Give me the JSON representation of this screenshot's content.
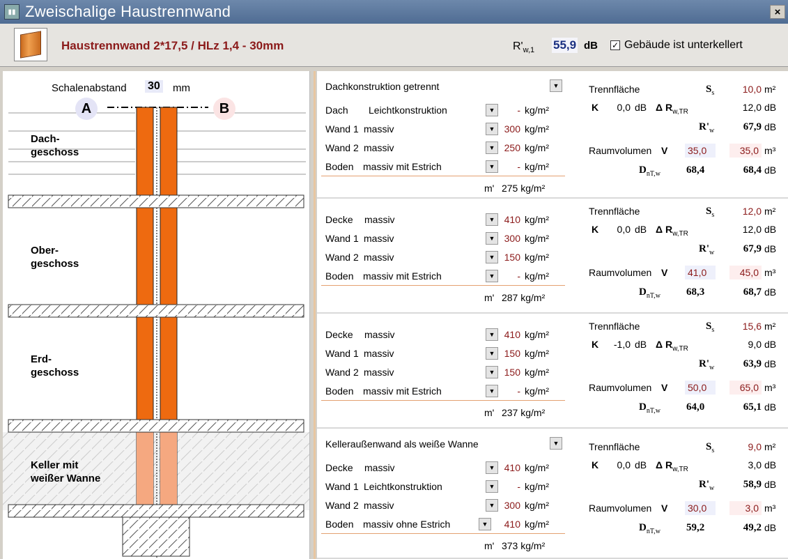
{
  "window": {
    "title": "Zweischalige Haustrennwand",
    "close": "×"
  },
  "header": {
    "wall_name": "Haustrennwand 2*17,5 / HLz 1,4 - 30mm",
    "rw_label": "R'",
    "rw_sub": "w,1",
    "rw_value": "55,9",
    "rw_unit": "dB",
    "basement_checked": true,
    "basement_label": "Gebäude ist unterkellert"
  },
  "diagram": {
    "spacing_label": "Schalenabstand",
    "spacing_value": "30",
    "spacing_unit": "mm",
    "side_a": "A",
    "side_b": "B",
    "floors": [
      {
        "l1": "Dach-",
        "l2": "geschoss"
      },
      {
        "l1": "Ober-",
        "l2": "geschoss"
      },
      {
        "l1": "Erd-",
        "l2": "geschoss"
      },
      {
        "l1": "Keller mit",
        "l2": "weißer Wanne"
      }
    ]
  },
  "units": {
    "kgm2": "kg/m²",
    "m2": "m²",
    "m3": "m³",
    "db": "dB",
    "dash": "-",
    "mprime": "m'"
  },
  "labels": {
    "trennflaeche": "Trennfläche",
    "ss": "S",
    "ss_sub": "s",
    "k": "K",
    "delta_r": "Δ R",
    "delta_r_sub": "w,TR",
    "r_w": "R'",
    "r_w_sub": "w",
    "raumvolumen": "Raumvolumen",
    "v": "V",
    "dnt": "D",
    "dnt_sub": "nT,w"
  },
  "sections": [
    {
      "title": "Dachkonstruktion getrennt",
      "rows": [
        {
          "label": "Dach",
          "value": "Leichtkonstruktion",
          "mass": "-"
        },
        {
          "label": "Wand 1",
          "value": "massiv",
          "mass": "300"
        },
        {
          "label": "Wand 2",
          "value": "massiv",
          "mass": "250"
        },
        {
          "label": "Boden",
          "value": "massiv mit Estrich",
          "mass": "-"
        }
      ],
      "m_total": "275",
      "ss": "10,0",
      "k": "0,0",
      "delta": "12,0",
      "r": "67,9",
      "v1": "35,0",
      "v2": "35,0",
      "d1": "68,4",
      "d2": "68,4"
    },
    {
      "title": "",
      "rows": [
        {
          "label": "Decke",
          "value": "massiv",
          "mass": "410"
        },
        {
          "label": "Wand 1",
          "value": "massiv",
          "mass": "300"
        },
        {
          "label": "Wand 2",
          "value": "massiv",
          "mass": "150"
        },
        {
          "label": "Boden",
          "value": "massiv mit Estrich",
          "mass": "-"
        }
      ],
      "m_total": "287",
      "ss": "12,0",
      "k": "0,0",
      "delta": "12,0",
      "r": "67,9",
      "v1": "41,0",
      "v2": "45,0",
      "d1": "68,3",
      "d2": "68,7"
    },
    {
      "title": "",
      "rows": [
        {
          "label": "Decke",
          "value": "massiv",
          "mass": "410"
        },
        {
          "label": "Wand 1",
          "value": "massiv",
          "mass": "150"
        },
        {
          "label": "Wand 2",
          "value": "massiv",
          "mass": "150"
        },
        {
          "label": "Boden",
          "value": "massiv mit Estrich",
          "mass": "-"
        }
      ],
      "m_total": "237",
      "ss": "15,6",
      "k": "-1,0",
      "delta": "9,0",
      "r": "63,9",
      "v1": "50,0",
      "v2": "65,0",
      "d1": "64,0",
      "d2": "65,1"
    },
    {
      "title": "Kelleraußenwand als weiße Wanne",
      "rows": [
        {
          "label": "Decke",
          "value": "massiv",
          "mass": "410"
        },
        {
          "label": "Wand 1",
          "value": "Leichtkonstruktion",
          "mass": "-"
        },
        {
          "label": "Wand 2",
          "value": "massiv",
          "mass": "300"
        },
        {
          "label": "Boden",
          "value": "massiv ohne Estrich",
          "mass": "410"
        }
      ],
      "m_total": "373",
      "ss": "9,0",
      "k": "0,0",
      "delta": "3,0",
      "r": "58,9",
      "v1": "30,0",
      "v2": "3,0",
      "d1": "59,2",
      "d2": "49,2"
    }
  ]
}
